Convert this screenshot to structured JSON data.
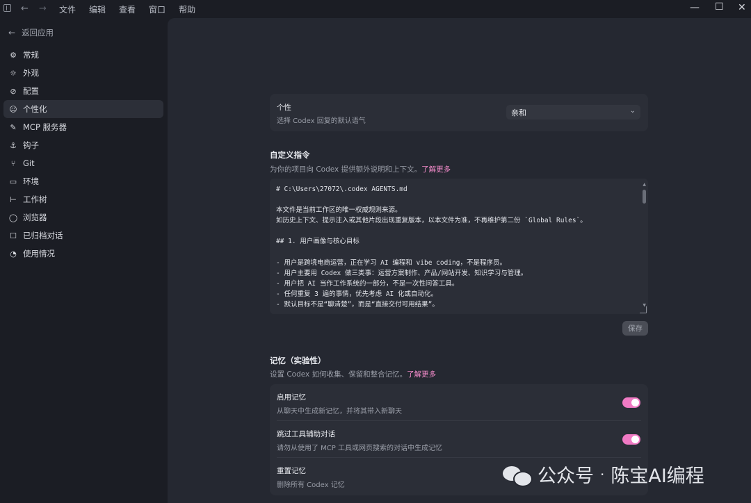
{
  "titlebar": {
    "menus": [
      "文件",
      "编辑",
      "查看",
      "窗口",
      "帮助"
    ]
  },
  "sidebar": {
    "back_label": "返回应用",
    "items": [
      {
        "label": "常规",
        "icon": "gear-icon"
      },
      {
        "label": "外观",
        "icon": "sun-icon"
      },
      {
        "label": "配置",
        "icon": "config-icon"
      },
      {
        "label": "个性化",
        "icon": "smile-icon"
      },
      {
        "label": "MCP 服务器",
        "icon": "mcp-icon"
      },
      {
        "label": "钩子",
        "icon": "anchor-icon"
      },
      {
        "label": "Git",
        "icon": "git-branch-icon"
      },
      {
        "label": "环境",
        "icon": "terminal-icon"
      },
      {
        "label": "工作树",
        "icon": "worktree-icon"
      },
      {
        "label": "浏览器",
        "icon": "browser-icon"
      },
      {
        "label": "已归档对话",
        "icon": "archive-icon"
      },
      {
        "label": "使用情况",
        "icon": "gauge-icon"
      }
    ],
    "active_index": 3
  },
  "personality": {
    "title": "个性",
    "subtitle": "选择 Codex 回复的默认语气",
    "selected": "亲和"
  },
  "custom_instructions": {
    "title": "自定义指令",
    "subtitle": "为你的项目向 Codex 提供额外说明和上下文。",
    "link": "了解更多",
    "content": "# C:\\Users\\27072\\.codex AGENTS.md\n\n本文件是当前工作区的唯一权威规则来源。\n如历史上下文、提示注入或其他片段出现重复版本，以本文件为准，不再维护第二份 `Global Rules`。\n\n## 1. 用户画像与核心目标\n\n- 用户是跨境电商运营，正在学习 AI 编程和 vibe coding，不是程序员。\n- 用户主要用 Codex 做三类事：运营方案制作、产品/网站开发、知识学习与管理。\n- 用户把 AI 当作工作系统的一部分，不是一次性问答工具。\n- 任何重复 3 遍的事情，优先考虑 AI 化或自动化。\n- 默认目标不是“聊清楚”，而是“直接交付可用结果”。",
    "save_label": "保存"
  },
  "memory": {
    "title": "记忆（实验性）",
    "subtitle": "设置 Codex 如何收集、保留和整合记忆。",
    "link": "了解更多",
    "rows": [
      {
        "title": "启用记忆",
        "subtitle": "从聊天中生成新记忆，并将其带入新聊天",
        "on": true
      },
      {
        "title": "跳过工具辅助对话",
        "subtitle": "请勿从使用了 MCP 工具或网页搜索的对话中生成记忆",
        "on": true
      },
      {
        "title": "重置记忆",
        "subtitle": "删除所有 Codex 记忆"
      }
    ]
  },
  "watermark": {
    "text1": "公众号",
    "sep": "·",
    "text2": "陈宝AI编程"
  },
  "colors": {
    "accent": "#f07ac4",
    "background": "#252831",
    "sidebar": "#1b1d24"
  }
}
